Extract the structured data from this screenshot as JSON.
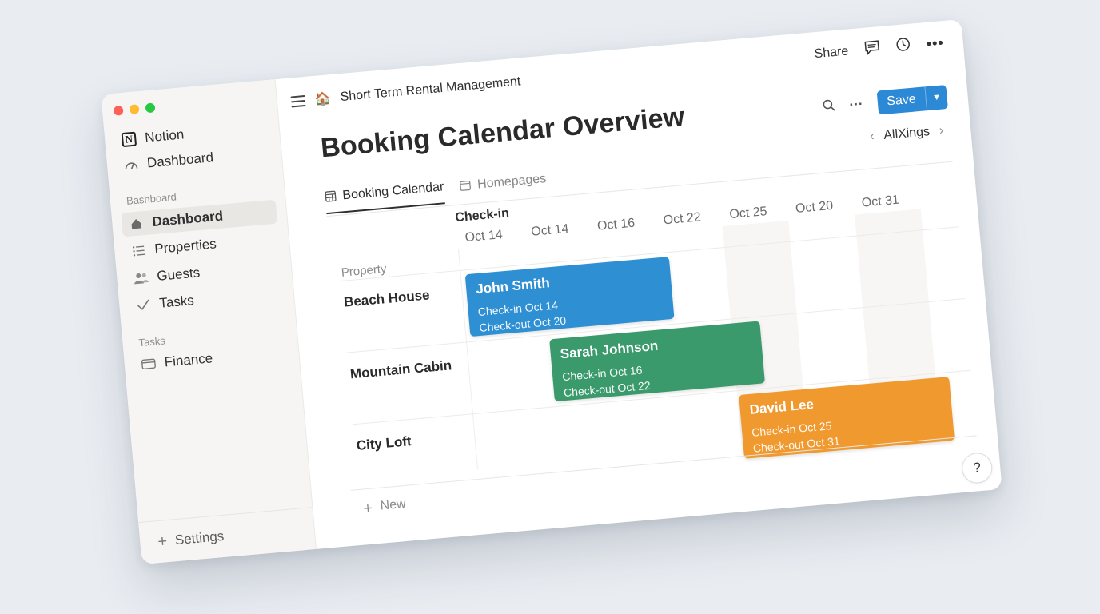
{
  "sidebar": {
    "workspace": "Notion",
    "top_items": [
      {
        "label": "Dashboard",
        "icon": "gauge-icon"
      }
    ],
    "section_dashboard": "Bashboard",
    "items": [
      {
        "label": "Dashboard",
        "icon": "home-icon",
        "active": true
      },
      {
        "label": "Properties",
        "icon": "list-icon"
      },
      {
        "label": "Guests",
        "icon": "people-icon"
      },
      {
        "label": "Tasks",
        "icon": "check-icon"
      }
    ],
    "section_tasks": "Tasks",
    "task_items": [
      {
        "label": "Finance",
        "icon": "card-icon"
      }
    ],
    "settings": "Settings"
  },
  "header": {
    "breadcrumb_emoji": "🏠",
    "breadcrumb": "Short Term Rental Management",
    "share": "Share"
  },
  "page": {
    "title": "Booking Calendar Overview",
    "save": "Save",
    "nav_label": "AllXings",
    "tabs": [
      {
        "label": "Booking Calendar",
        "active": true
      },
      {
        "label": "Homepages",
        "active": false
      }
    ]
  },
  "calendar": {
    "axis_label": "Check-in",
    "property_header": "Property",
    "dates": [
      "Oct 14",
      "Oct 14",
      "Oct 16",
      "Oct 22",
      "Oct 25",
      "Oct 20",
      "Oct 31"
    ],
    "properties": [
      "Beach House",
      "Mountain Cabin",
      "City Loft"
    ],
    "bookings": [
      {
        "guest": "John Smith",
        "checkin": "Check-in Oct 14",
        "checkout": "Check-out Oct 20",
        "color": "#2e8fd3"
      },
      {
        "guest": "Sarah Johnson",
        "checkin": "Check-in Oct 16",
        "checkout": "Check-out Oct 22",
        "color": "#3a9a6c"
      },
      {
        "guest": "David Lee",
        "checkin": "Check-in Oct 25",
        "checkout": "Check-out Oct 31",
        "color": "#f0992e"
      }
    ]
  },
  "footer": {
    "new": "New",
    "help": "?"
  },
  "colors": {
    "accent": "#2c89d6",
    "sidebar_bg": "#f6f5f3"
  }
}
